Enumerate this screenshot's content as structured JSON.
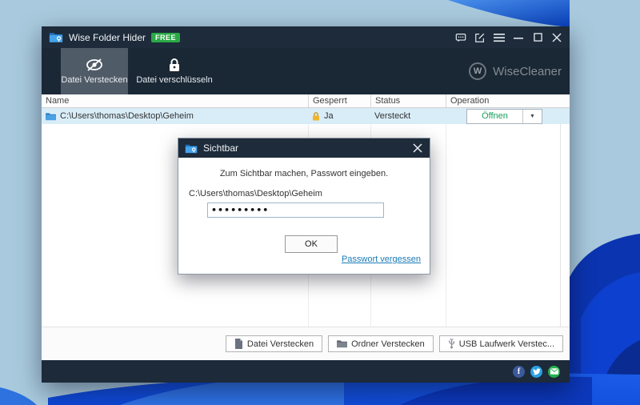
{
  "window": {
    "title": "Wise Folder Hider",
    "badge": "FREE",
    "titlebar_icons": [
      "feedback-icon",
      "edit-icon",
      "menu-icon",
      "minimize-icon",
      "maximize-icon",
      "close-icon"
    ],
    "tabs": [
      {
        "label": "Datei Verstecken",
        "icon": "eye-off-icon",
        "active": true
      },
      {
        "label": "Datei verschlüsseln",
        "icon": "lock-icon",
        "active": false
      }
    ],
    "brand": {
      "logo_letter": "W",
      "name": "WiseCleaner"
    },
    "table": {
      "columns": [
        "Name",
        "Gesperrt",
        "Status",
        "Operation"
      ],
      "row": {
        "name": "C:\\Users\\thomas\\Desktop\\Geheim",
        "gesperrt": "Ja",
        "status": "Versteckt",
        "operation_label": "Öffnen",
        "operation_arrow": "▼"
      }
    },
    "bottom_buttons": [
      {
        "label": "Datei Verstecken",
        "icon": "file-icon"
      },
      {
        "label": "Ordner Verstecken",
        "icon": "folder-icon"
      },
      {
        "label": "USB Laufwerk Verstec...",
        "icon": "usb-icon"
      }
    ],
    "footer_social": [
      "facebook-icon",
      "twitter-icon",
      "email-icon"
    ],
    "facebook_letter": "f"
  },
  "dialog": {
    "title": "Sichtbar",
    "message": "Zum Sichtbar machen, Passwort eingeben.",
    "path_label": "C:\\Users\\thomas\\Desktop\\Geheim",
    "password_value": "•••••••••",
    "ok_label": "OK",
    "forgot_link": "Passwort vergessen"
  },
  "colors": {
    "titlebar": "#1d2b3a",
    "free_badge": "#2aa945",
    "open_button_text": "#17a05c",
    "row_highlight": "#d9edf8",
    "link": "#1b7bb7",
    "wallpaper_base": "#a9cade",
    "wallpaper_deep_blue": "#0b34b0"
  }
}
